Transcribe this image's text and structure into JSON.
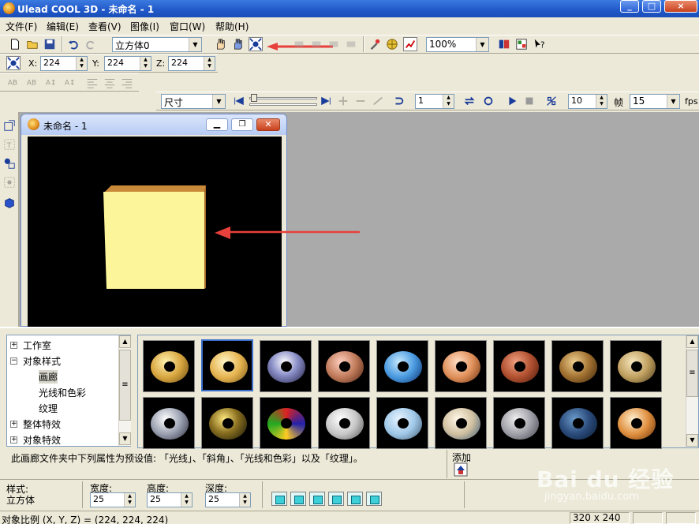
{
  "window": {
    "title": "Ulead COOL 3D - 未命名 - 1",
    "controls": [
      "_",
      "□",
      "×"
    ]
  },
  "menu": [
    "文件(F)",
    "编辑(E)",
    "查看(V)",
    "图像(I)",
    "窗口(W)",
    "帮助(H)"
  ],
  "toolbar": {
    "object_select": "立方体0",
    "zoom": "100%"
  },
  "position": {
    "x_label": "X:",
    "x": "224",
    "y_label": "Y:",
    "y": "224",
    "z_label": "Z:",
    "z": "224"
  },
  "animation": {
    "property_select": "尺寸",
    "frame": "1",
    "frame_count": "10",
    "frame_label": "帧",
    "fps": "15",
    "fps_label": "fps"
  },
  "document": {
    "title": "未命名 - 1"
  },
  "tree": {
    "items": [
      "工作室",
      "对象样式",
      "画廊",
      "光线和色彩",
      "纹理",
      "整体特效",
      "对象特效"
    ]
  },
  "description": "此画廊文件夹中下列属性为预设值: 「光线」、「斜角」、「光线和色彩」以及「纹理」。",
  "add_label": "添加",
  "properties": {
    "style_label": "样式:",
    "style_value": "立方体",
    "width_label": "宽度:",
    "width": "25",
    "height_label": "高度:",
    "height": "25",
    "depth_label": "深度:",
    "depth": "25"
  },
  "status": {
    "scale": "对象比例 (X, Y, Z) = (224, 224, 224)",
    "size": "320 x 240"
  },
  "watermark": {
    "logo": "Bai du 经验",
    "url": "jingyan.baidu.com"
  },
  "colors": {
    "titlebar": "#2058c8",
    "canvas": "#000000",
    "cube": "#fdf59a",
    "arrow": "#e8403a",
    "workspace": "#aaaaaa"
  }
}
